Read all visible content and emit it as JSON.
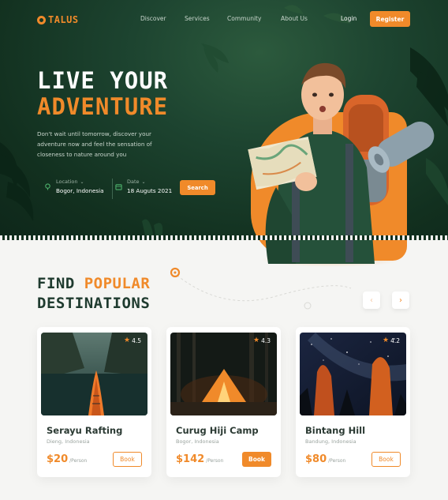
{
  "brand": {
    "name": "TALUS"
  },
  "nav": {
    "items": [
      "Discover",
      "Services",
      "Community",
      "About Us"
    ],
    "login": "Login",
    "register": "Register"
  },
  "hero": {
    "headline_1": "LIVE YOUR",
    "headline_2": "ADVENTURE",
    "subcopy": "Don't wait until tomorrow, discover your adventure now and feel the sensation of closeness to nature around you",
    "location_label": "Location",
    "location_value": "Bogor, Indonesia",
    "date_label": "Date",
    "date_value": "18 Auguts 2021",
    "search": "Search"
  },
  "destinations": {
    "title_1": "FIND ",
    "title_2": "POPULAR",
    "title_3": "DESTINATIONS",
    "prev_icon": "chevron-left-icon",
    "next_icon": "chevron-right-icon",
    "cards": [
      {
        "name": "Serayu Rafting",
        "location": "Dieng, Indonesia",
        "price": "$20",
        "unit": "/Person",
        "rating": "4.5",
        "button": "Book",
        "button_style": "outline"
      },
      {
        "name": "Curug Hiji Camp",
        "location": "Bogor, Indonesia",
        "price": "$142",
        "unit": "/Person",
        "rating": "4.3",
        "button": "Book",
        "button_style": "filled"
      },
      {
        "name": "Bintang Hill",
        "location": "Bandung, Indonesia",
        "price": "$80",
        "unit": "/Person",
        "rating": "4.2",
        "button": "Book",
        "button_style": "outline"
      }
    ]
  },
  "colors": {
    "accent": "#f08a2a",
    "hero_dark": "#12301f",
    "heading": "#1f3b2f",
    "background": "#f5f5f3"
  }
}
